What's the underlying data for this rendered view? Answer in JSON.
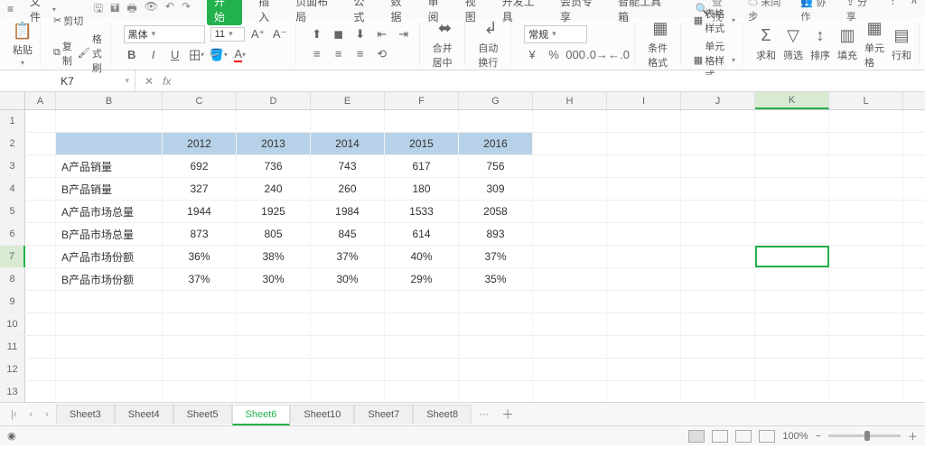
{
  "menu": {
    "file": "文件",
    "tabs": [
      "开始",
      "插入",
      "页面布局",
      "公式",
      "数据",
      "审阅",
      "视图",
      "开发工具",
      "会员专享",
      "智能工具箱"
    ],
    "search": "查找",
    "cloud": {
      "unsync": "未同步",
      "collab": "协作",
      "share": "分享"
    }
  },
  "ribbon": {
    "paste": "粘贴",
    "cut": "剪切",
    "copy": "复制",
    "fmtpaint": "格式刷",
    "font": "黑体",
    "size": "11",
    "merge": "合并居中",
    "wrap": "自动换行",
    "numfmt": "常规",
    "condfmt": "条件格式",
    "tablefmt": "表格样式",
    "cellfmt": "单元格样式",
    "sum": "求和",
    "filter": "筛选",
    "sort": "排序",
    "fill": "填充",
    "cells": "单元格",
    "rowcol": "行和"
  },
  "namebox": "K7",
  "columns": [
    "A",
    "B",
    "C",
    "D",
    "E",
    "F",
    "G",
    "H",
    "I",
    "J",
    "K",
    "L"
  ],
  "chart_data": {
    "type": "table",
    "header_col": "B",
    "year_cols": [
      "C",
      "D",
      "E",
      "F",
      "G"
    ],
    "years": [
      "2012",
      "2013",
      "2014",
      "2015",
      "2016"
    ],
    "rows": [
      {
        "label": "A产品销量",
        "values": [
          "692",
          "736",
          "743",
          "617",
          "756"
        ]
      },
      {
        "label": "B产品销量",
        "values": [
          "327",
          "240",
          "260",
          "180",
          "309"
        ]
      },
      {
        "label": "A产品市场总量",
        "values": [
          "1944",
          "1925",
          "1984",
          "1533",
          "2058"
        ]
      },
      {
        "label": "B产品市场总量",
        "values": [
          "873",
          "805",
          "845",
          "614",
          "893"
        ]
      },
      {
        "label": "A产品市场份额",
        "values": [
          "36%",
          "38%",
          "37%",
          "40%",
          "37%"
        ]
      },
      {
        "label": "B产品市场份额",
        "values": [
          "37%",
          "30%",
          "30%",
          "29%",
          "35%"
        ]
      }
    ]
  },
  "sheets": {
    "list": [
      "Sheet3",
      "Sheet4",
      "Sheet5",
      "Sheet6",
      "Sheet10",
      "Sheet7",
      "Sheet8"
    ],
    "active": "Sheet6"
  },
  "status": {
    "zoom": "100%"
  }
}
